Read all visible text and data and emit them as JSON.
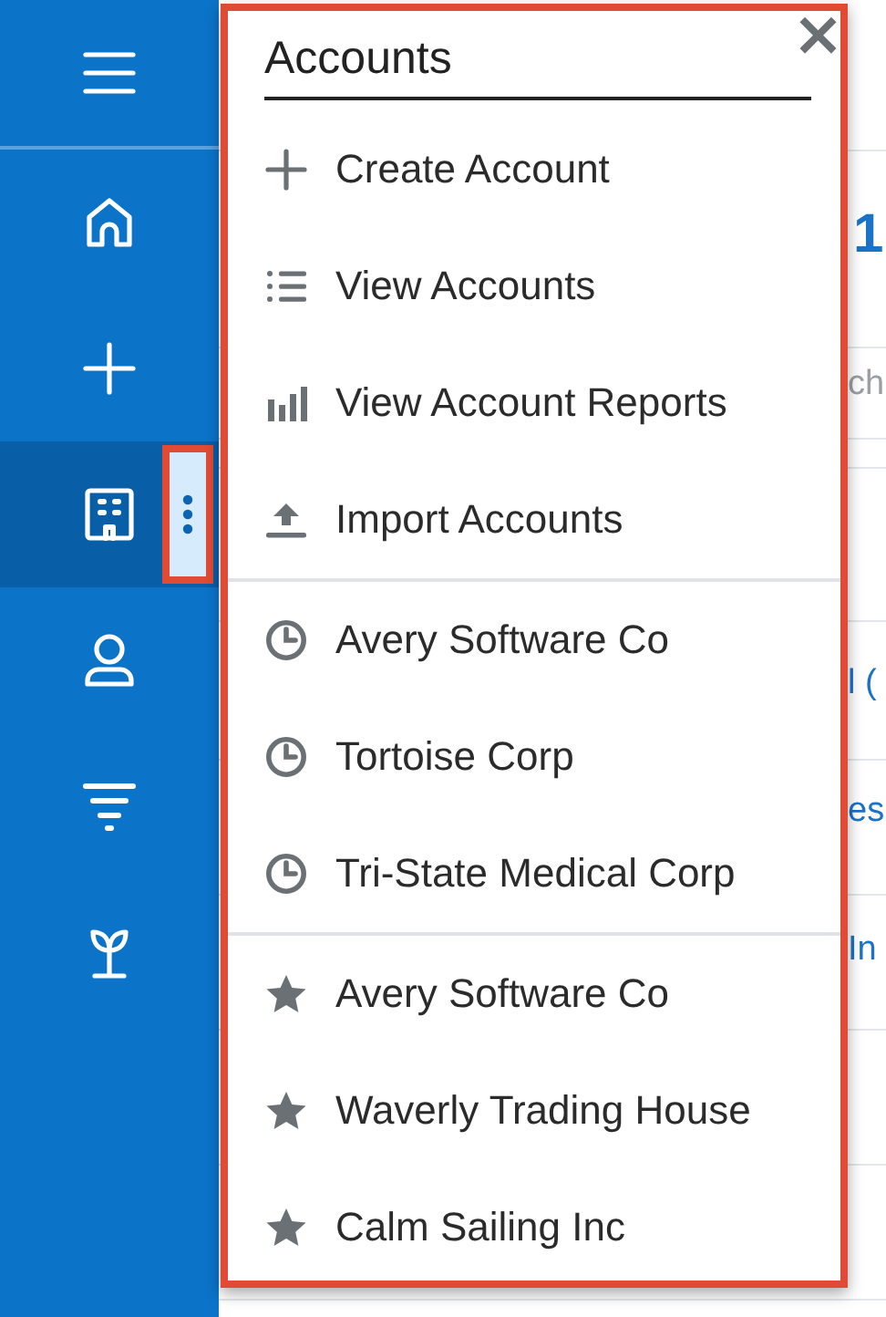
{
  "sidebar": {
    "items": [
      {
        "selected": false
      },
      {
        "selected": false
      },
      {
        "selected": false
      },
      {
        "selected": true
      },
      {
        "selected": false
      },
      {
        "selected": false
      },
      {
        "selected": false
      }
    ]
  },
  "background": {
    "fragments": [
      {
        "text": "1",
        "kind": "title"
      },
      {
        "text": "ch",
        "kind": "muted"
      },
      {
        "text": "l (",
        "kind": "link"
      },
      {
        "text": "es",
        "kind": "link"
      },
      {
        "text": "In",
        "kind": "link"
      }
    ]
  },
  "menu": {
    "title": "Accounts",
    "close": "×",
    "sections": [
      [
        {
          "kind": "action",
          "label": "Create Account"
        },
        {
          "kind": "action",
          "label": "View Accounts"
        },
        {
          "kind": "action",
          "label": "View Account Reports"
        },
        {
          "kind": "action",
          "label": "Import Accounts"
        }
      ],
      [
        {
          "kind": "recent",
          "label": "Avery Software Co"
        },
        {
          "kind": "recent",
          "label": "Tortoise Corp"
        },
        {
          "kind": "recent",
          "label": "Tri-State Medical Corp"
        }
      ],
      [
        {
          "kind": "favorite",
          "label": "Avery Software Co"
        },
        {
          "kind": "favorite",
          "label": "Waverly Trading House"
        },
        {
          "kind": "favorite",
          "label": "Calm Sailing Inc"
        }
      ]
    ]
  }
}
